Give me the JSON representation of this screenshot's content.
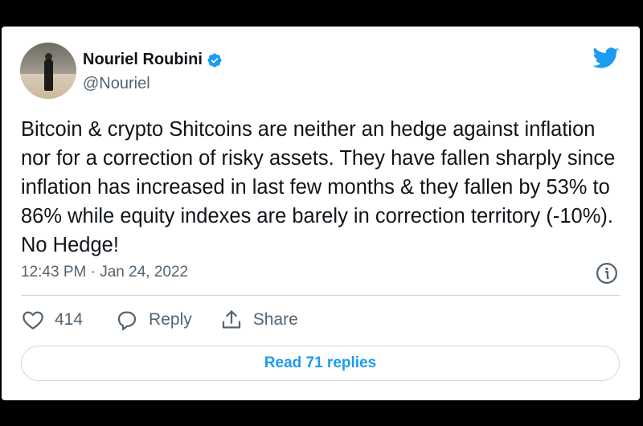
{
  "author": {
    "name": "Nouriel Roubini",
    "handle": "@Nouriel",
    "verified": true,
    "avatar_icon": "profile-photo"
  },
  "tweet": {
    "text": "Bitcoin & crypto Shitcoins are neither an hedge against inflation nor for a correction of risky assets. They have fallen sharply since inflation has increased in last few months & they fallen by 53% to 86% while equity indexes are barely in correction territory (-10%). No Hedge!",
    "timestamp": "12:43 PM · Jan 24, 2022"
  },
  "actions": {
    "like_count": "414",
    "reply_label": "Reply",
    "share_label": "Share"
  },
  "footer": {
    "read_replies_label": "Read 71 replies"
  },
  "icons": {
    "brand": "twitter-bird-icon",
    "verified": "verified-badge-icon",
    "info": "info-icon",
    "like": "heart-icon",
    "reply": "reply-bubble-icon",
    "share": "share-icon"
  },
  "colors": {
    "brand_blue": "#1d9bf0",
    "text_primary": "#0f1419",
    "text_secondary": "#536471",
    "border": "#cfd9de",
    "frame": "#000000"
  }
}
